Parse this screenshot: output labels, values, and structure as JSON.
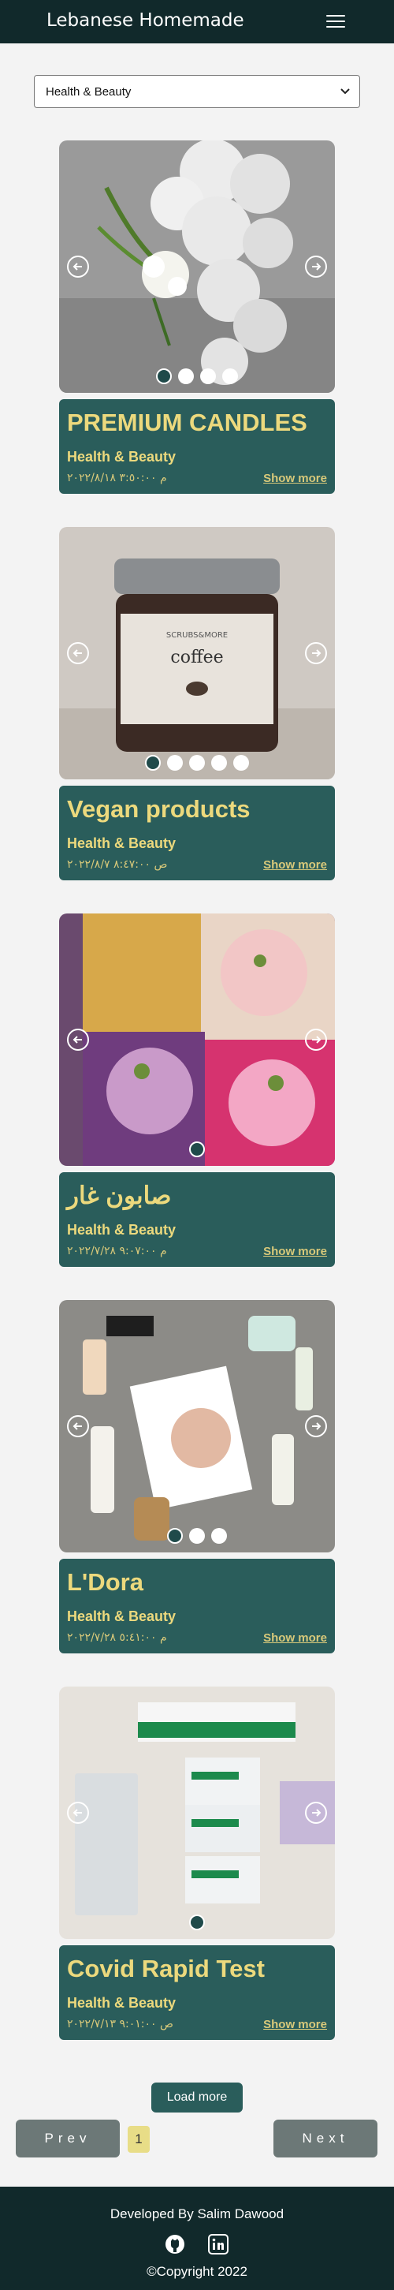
{
  "header": {
    "brand": "Lebanese Homemade",
    "menu_icon": "hamburger-icon"
  },
  "filter": {
    "selected": "Health & Beauty"
  },
  "products": [
    {
      "title": "PREMIUM CANDLES",
      "category": "Health & Beauty",
      "date": "م ٣:٥٠:٠٠ ٢٠٢٢/٨/١٨",
      "more": "Show more",
      "slides": 4,
      "active_slide": 1
    },
    {
      "title": "Vegan products",
      "category": "Health & Beauty",
      "date": "ص ٨:٤٧:٠٠ ٢٠٢٢/٨/٧",
      "more": "Show more",
      "slides": 5,
      "active_slide": 1
    },
    {
      "title": "صابون غار",
      "category": "Health & Beauty",
      "date": "م ٩:٠٧:٠٠ ٢٠٢٢/٧/٢٨",
      "more": "Show more",
      "slides": 1,
      "active_slide": 1
    },
    {
      "title": "L'Dora",
      "category": "Health & Beauty",
      "date": "م ٥:٤١:٠٠ ٢٠٢٢/٧/٢٨",
      "more": "Show more",
      "slides": 3,
      "active_slide": 1
    },
    {
      "title": "Covid Rapid Test",
      "category": "Health & Beauty",
      "date": "ص ٩:٠١:٠٠ ٢٠٢٢/٧/١٣",
      "more": "Show more",
      "slides": 1,
      "active_slide": 1
    }
  ],
  "load_more": "Load more",
  "pagination": {
    "prev": "Prev",
    "page": "1",
    "next": "Next"
  },
  "footer": {
    "credit": "Developed By Salim Dawood",
    "copyright": "©Copyright 2022",
    "icons": [
      "github-icon",
      "linkedin-icon"
    ]
  },
  "colors": {
    "topbar": "#11292b",
    "card_info": "#2a5d5b",
    "title_text": "#ecd97d",
    "pagination_button": "#6c7877",
    "page_badge": "#e8dd87"
  }
}
